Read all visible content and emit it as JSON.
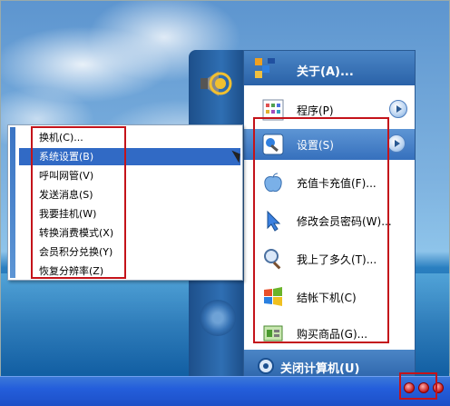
{
  "main_menu": {
    "header": "关于(A)...",
    "items": [
      {
        "label": "程序(P)",
        "icon": "programs-icon",
        "has_arrow": true
      },
      {
        "label": "设置(S)",
        "icon": "settings-icon",
        "has_arrow": true,
        "selected": true
      },
      {
        "label": "充值卡充值(F)...",
        "icon": "apple-icon"
      },
      {
        "label": "修改会员密码(W)...",
        "icon": "pointer-icon"
      },
      {
        "label": "我上了多久(T)...",
        "icon": "magnifier-icon"
      },
      {
        "label": "结帐下机(C)",
        "icon": "windows-logo-icon"
      },
      {
        "label": "购买商品(G)...",
        "icon": "shopping-icon"
      }
    ],
    "footer": "关闭计算机(U)"
  },
  "sub_menu": {
    "items": [
      {
        "label": "换机(C)..."
      },
      {
        "label": "系统设置(B)",
        "selected": true
      },
      {
        "label": "呼叫网管(V)"
      },
      {
        "label": "发送消息(S)"
      },
      {
        "label": "我要挂机(W)"
      },
      {
        "label": "转换消费模式(X)"
      },
      {
        "label": "会员积分兑换(Y)"
      },
      {
        "label": "恢复分辨率(Z)"
      }
    ]
  },
  "colors": {
    "highlight_border": "#c4131a",
    "menu_blue": "#2a62a8",
    "selection_blue": "#316ac5"
  }
}
